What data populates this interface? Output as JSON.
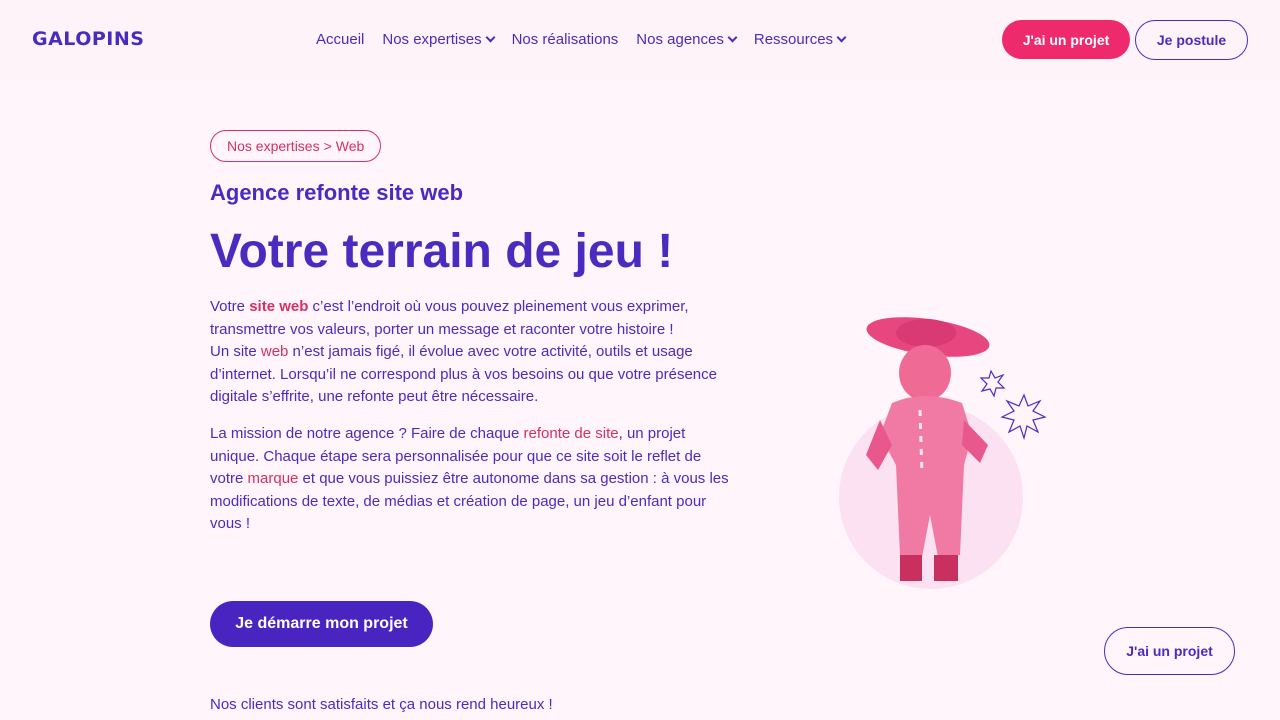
{
  "header": {
    "logo": "GALOPINS",
    "nav": [
      {
        "label": "Accueil",
        "dropdown": false
      },
      {
        "label": "Nos expertises",
        "dropdown": true
      },
      {
        "label": "Nos réalisations",
        "dropdown": false
      },
      {
        "label": "Nos agences",
        "dropdown": true
      },
      {
        "label": "Ressources",
        "dropdown": true
      }
    ],
    "cta_project": "J'ai un projet",
    "cta_postule": "Je postule"
  },
  "hero": {
    "breadcrumb": {
      "parent": "Nos expertises",
      "separator": ">",
      "current": "Web"
    },
    "subtitle": "Agence refonte site web",
    "headline": "Votre terrain de jeu !",
    "p1": {
      "a": "Votre ",
      "b": "site web",
      "c": " c’est l’endroit où vous pouvez pleinement vous exprimer, transmettre vos valeurs, porter un message et raconter votre histoire !",
      "d": "Un site ",
      "e": "web",
      "f": " n’est jamais figé, il évolue avec votre activité, outils et usage d’internet. Lorsqu’il ne correspond plus à vos besoins ou que votre présence digitale s’effrite, une refonte peut être nécessaire."
    },
    "p2": {
      "a": "La mission de notre agence ? Faire de chaque ",
      "b": "refonte de site",
      "c": ", un projet unique. Chaque étape sera personnalisée pour que ce site soit le reflet de votre ",
      "d": "marque",
      "e": " et que vous puissiez être autonome dans sa gestion : à vous les modifications de texte, de médias et création de page, un jeu d’enfant pour vous !"
    },
    "cta": "Je démarre mon projet"
  },
  "floating_cta": "J'ai un projet",
  "clients_text": "Nos clients sont satisfaits et ça nous rend heureux !",
  "colors": {
    "primary": "#4a2bbf",
    "accent": "#ee2a6c",
    "pink_text": "#d8305f",
    "background": "#fff5fa"
  }
}
